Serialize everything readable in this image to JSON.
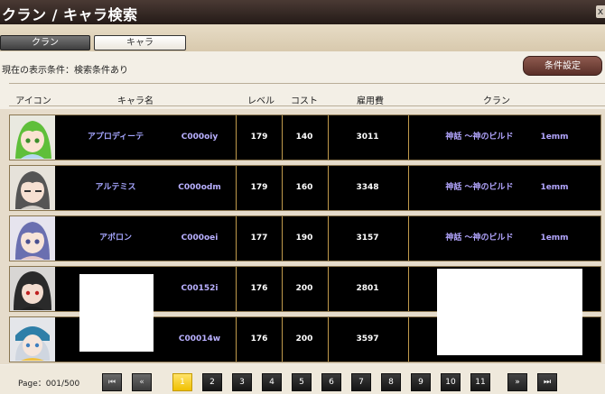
{
  "window": {
    "title": "クラン / キャラ検索",
    "close_label": "x"
  },
  "tabs": {
    "clan": "クラン",
    "chara": "キャラ"
  },
  "filter": {
    "condition_text": "現在の表示条件：検索条件あり",
    "settings_button": "条件設定"
  },
  "columns": {
    "icon": "アイコン",
    "name": "キャラ名",
    "level": "レベル",
    "cost": "コスト",
    "fee": "雇用費",
    "clan": "クラン"
  },
  "rows": [
    {
      "name": "アプロディーテ",
      "id": "C000oiy",
      "level": "179",
      "cost": "140",
      "fee": "3011",
      "clan_name": "神話 〜神のビルド",
      "clan_tag": "1emm",
      "avatar_hair": "#5fbf3a"
    },
    {
      "name": "アルテミス",
      "id": "C000odm",
      "level": "179",
      "cost": "160",
      "fee": "3348",
      "clan_name": "神話 〜神のビルド",
      "clan_tag": "1emm",
      "avatar_hair": "#555555"
    },
    {
      "name": "アポロン",
      "id": "C000oei",
      "level": "177",
      "cost": "190",
      "fee": "3157",
      "clan_name": "神話 〜神のビルド",
      "clan_tag": "1emm",
      "avatar_hair": "#6a6fb0"
    },
    {
      "name": "",
      "id": "C00152i",
      "level": "176",
      "cost": "200",
      "fee": "2801",
      "clan_name": "",
      "clan_tag": "",
      "avatar_hair": "#2a2a2a"
    },
    {
      "name": "",
      "id": "C00014w",
      "level": "176",
      "cost": "200",
      "fee": "3597",
      "clan_name": "",
      "clan_tag": "",
      "avatar_hair": "#cfd6e0"
    }
  ],
  "pager": {
    "label": "Page：001/500",
    "first_icon": "first-page-icon",
    "prev_icon": "prev-page-icon",
    "next_icon": "next-page-icon",
    "last_icon": "last-page-icon",
    "pages": [
      "1",
      "2",
      "3",
      "4",
      "5",
      "6",
      "7",
      "8",
      "9",
      "10",
      "11"
    ],
    "current": "1"
  }
}
